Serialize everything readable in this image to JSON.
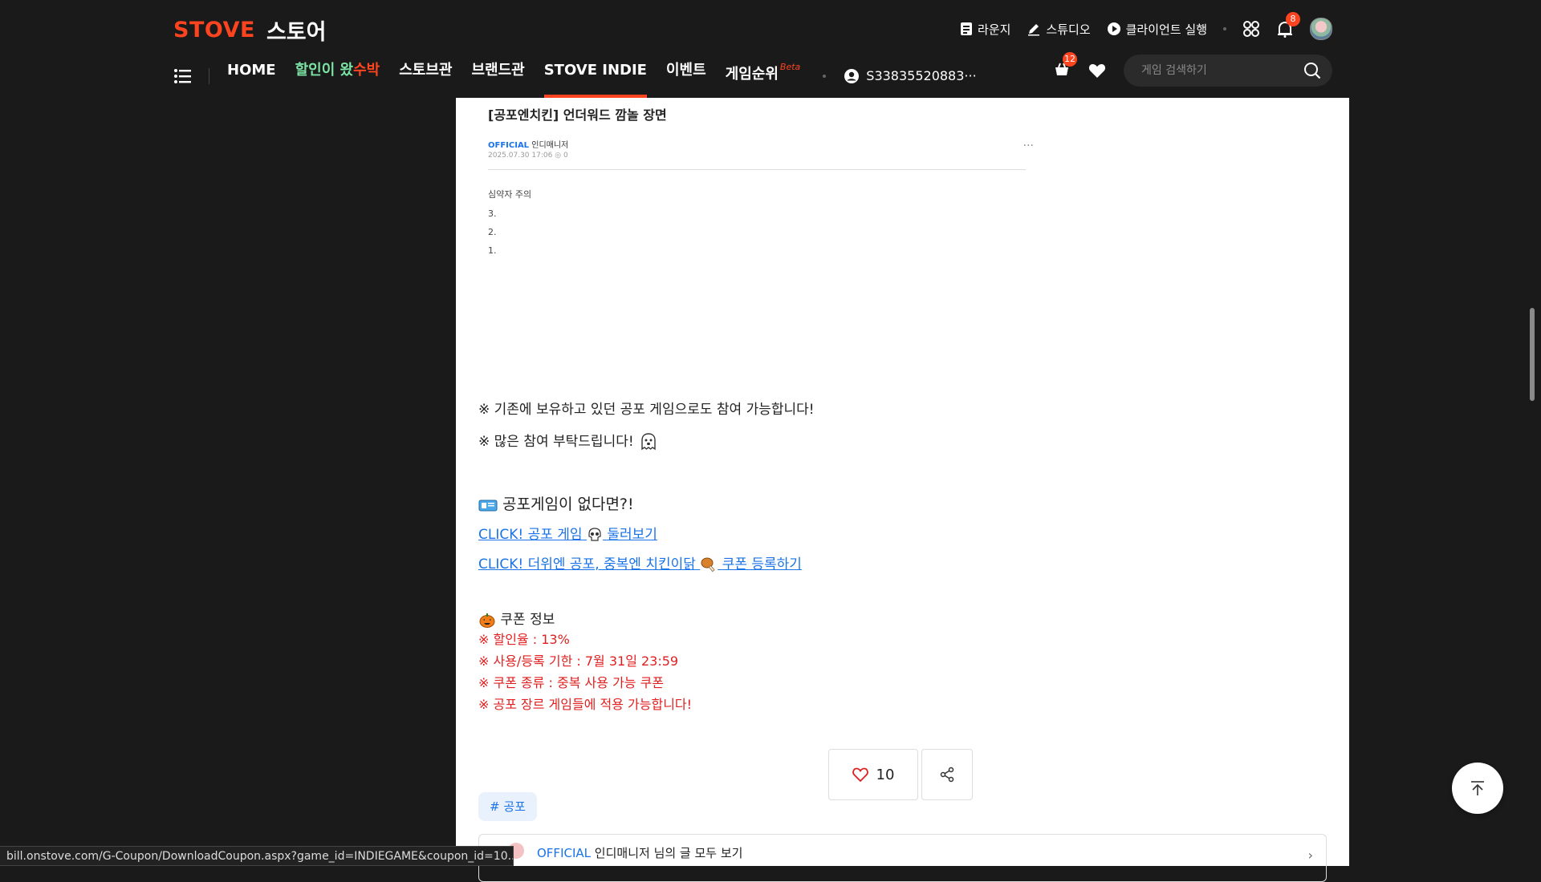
{
  "header": {
    "brand": "STOVE",
    "store_label": "스토어",
    "utils": {
      "lounge": "라운지",
      "studio": "스튜디오",
      "client": "클라이언트 실행",
      "notification_count": "8"
    },
    "nav": {
      "home": "HOME",
      "sale_part1": "할인이 왔",
      "sale_part2": "수박",
      "storebrand": "스토브관",
      "brand": "브랜드관",
      "indie": "STOVE INDIE",
      "event": "이벤트",
      "ranking": "게임순위",
      "ranking_beta": "Beta",
      "user_id": "S33835520883···"
    },
    "cart_count": "12",
    "search_placeholder": "게임 검색하기"
  },
  "embed": {
    "title": "[공포엔치킨] 언더워드 깜놀 장면",
    "official": "OFFICIAL",
    "author": "인디매니저",
    "date": "2025.07.30 17:06",
    "views": "0",
    "warning": "심약자 주의",
    "numbers": [
      "3.",
      "2.",
      "1."
    ]
  },
  "article": {
    "note1": "※ 기존에 보유하고 있던 공포 게임으로도 참여 가능합니다!",
    "note2": "※ 많은 참여 부탁드립니다!",
    "heading": "공포게임이 없다면?!",
    "link1_a": "CLICK! 공포 게임",
    "link1_b": "둘러보기",
    "link2_a": "CLICK! 더위엔 공포, 중복엔 치킨이닭",
    "link2_b": "쿠폰 등록하기",
    "coupon_heading": "쿠폰 정보",
    "coupon_lines": [
      "※ 할인율 : 13%",
      "※ 사용/등록 기한 : 7월 31일 23:59",
      "※ 쿠폰 종류 : 중복 사용 가능 쿠폰",
      "※ 공포 장르 게임들에 적용 가능합니다!"
    ],
    "tag": "# 공포",
    "like_count": "10"
  },
  "author_box": {
    "official": "OFFICIAL",
    "text": "인디매니저 님의 글 모두 보기"
  },
  "status_url": "bill.onstove.com/G-Coupon/DownloadCoupon.aspx?game_id=INDIEGAME&coupon_id=10...",
  "colors": {
    "accent": "#fc4420",
    "link": "#1a73e8",
    "coupon_red": "#e02020",
    "background": "#1a1a1a"
  }
}
